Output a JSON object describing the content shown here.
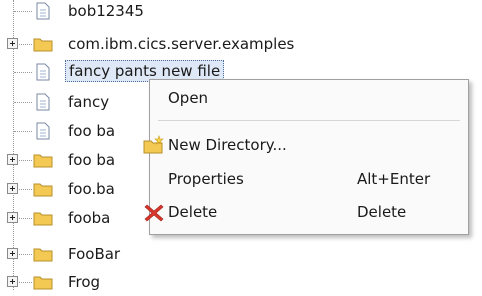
{
  "tree": {
    "items": [
      {
        "label": "bob12345",
        "type": "file",
        "expandable": false
      },
      {
        "label": "com.ibm.cics.server.examples",
        "type": "folder",
        "expandable": true
      },
      {
        "label": "fancy pants new file",
        "type": "file",
        "expandable": false,
        "selected": true
      },
      {
        "label": "fancy",
        "type": "file",
        "expandable": false
      },
      {
        "label": "foo ba",
        "type": "file",
        "expandable": false
      },
      {
        "label": "foo ba",
        "type": "folder",
        "expandable": true
      },
      {
        "label": "foo.ba",
        "type": "folder",
        "expandable": true
      },
      {
        "label": "fooba",
        "type": "folder",
        "expandable": true
      },
      {
        "label": "FooBar",
        "type": "folder",
        "expandable": true
      },
      {
        "label": "Frog",
        "type": "folder",
        "expandable": true
      }
    ]
  },
  "context_menu": {
    "open_label": "Open",
    "new_directory_label": "New Directory...",
    "properties_label": "Properties",
    "properties_shortcut": "Alt+Enter",
    "delete_label": "Delete",
    "delete_shortcut": "Delete"
  },
  "colors": {
    "folder": "#f0c24b",
    "selection": "#dfe8f6",
    "delete_icon": "#d2352b"
  }
}
